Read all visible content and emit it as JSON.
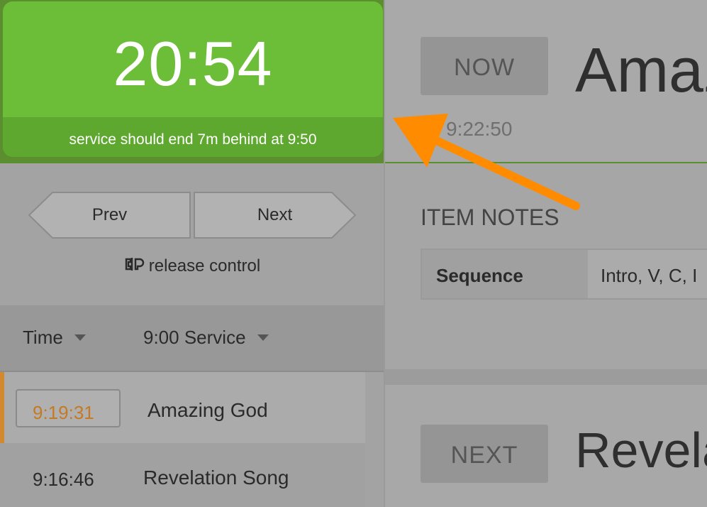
{
  "timer": {
    "value": "20:54",
    "status": "service should end 7m behind at 9:50"
  },
  "controls": {
    "prev_label": "Prev",
    "next_label": "Next",
    "release_label": "release control",
    "release_icon": "release-control-icon"
  },
  "filters": {
    "time_label": "Time",
    "service_label": "9:00 Service"
  },
  "plan_items": [
    {
      "time": "9:19:31",
      "title": "Amazing God",
      "current": true
    },
    {
      "time": "9:16:46",
      "title": "Revelation Song",
      "current": false
    }
  ],
  "now": {
    "badge": "NOW",
    "title": "Amaz",
    "time": "9:22:50"
  },
  "notes": {
    "heading": "ITEM NOTES",
    "key": "Sequence",
    "value": "Intro, V, C, I"
  },
  "next": {
    "badge": "NEXT",
    "title": "Revela"
  },
  "colors": {
    "timer_green": "#6cbd37",
    "accent_orange": "#d38a2e",
    "annotation_arrow": "#ff8c00"
  }
}
